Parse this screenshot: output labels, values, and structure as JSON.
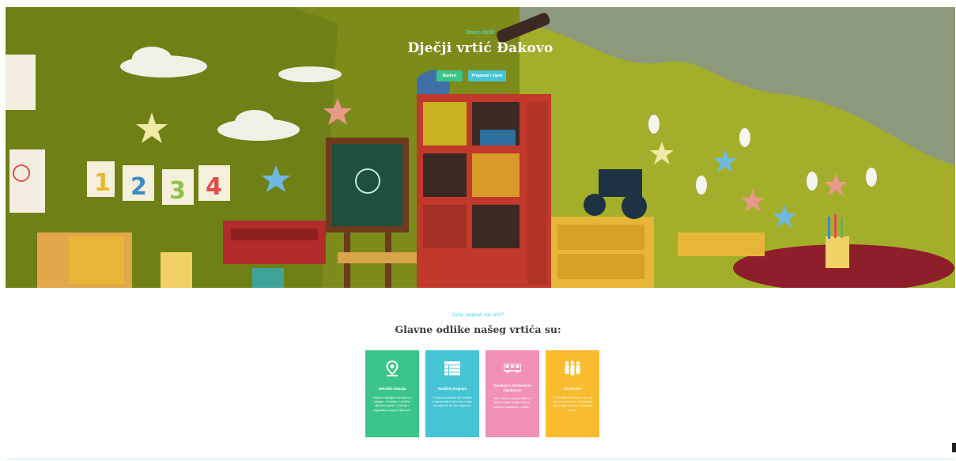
{
  "hero": {
    "kicker": "Dobro došli!",
    "title": "Dječji vrtić Đakovo",
    "btn_about": "Naslovi",
    "btn_programs": "Programi i cijeni"
  },
  "section": {
    "kicker": "Zašto odabrati naš vrtić?",
    "title": "Glavne odlike našeg vrtića su:"
  },
  "cards": [
    {
      "icon": "location-pin-icon",
      "title": "Nekoliko lokacija",
      "text": "Nalazimo djelujemo na ukupno 4 lokacije - 3 lokacije u različitim dijelovima grada i 1 lokacija u prigradskom naselju Piškorevci."
    },
    {
      "icon": "table-list-icon",
      "title": "Različiti programi",
      "text": "S ponosom nudimo više različitih programa kako bismo bez ovoga pruzajte ono što vam odgovara."
    },
    {
      "icon": "bus-icon",
      "title": "Suradnja s društvenom zajednicom",
      "text": "Izleti u kolovoz, posjeti Đakovu i okolici, posjeti drugim vrtićima, suradnja s knjižnicom i ostalim..."
    },
    {
      "icon": "people-team-icon",
      "title": "Stručni tim",
      "text": "Tvoriti ekiprosti učitelji, a ujed za izam što upizgo tim, pedagoginja, psihologinja i stručna medicinska sestra."
    }
  ],
  "colors": {
    "green": "#3cc58a",
    "teal": "#46c4d6",
    "pink": "#f191b7",
    "yellow": "#f8bc2e"
  }
}
